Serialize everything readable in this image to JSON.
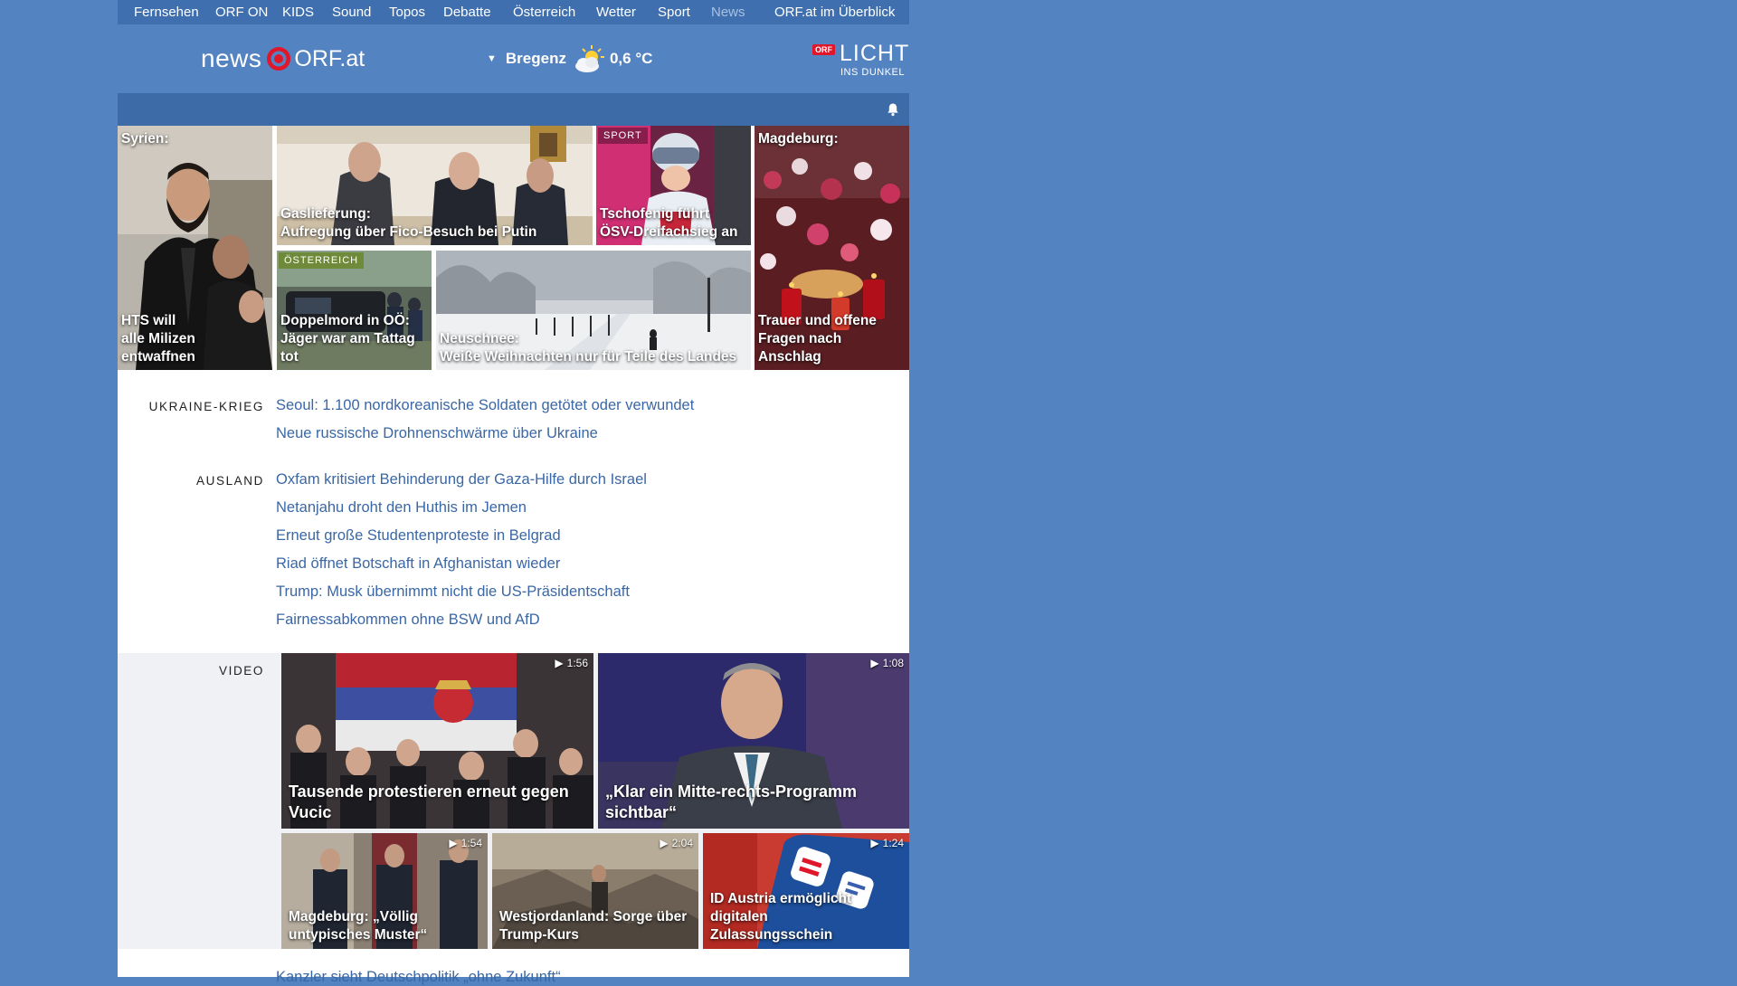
{
  "nav": {
    "items": [
      "Fernsehen",
      "ORF ON",
      "KIDS",
      "Sound",
      "Topos",
      "Debatte",
      "Österreich",
      "Wetter",
      "Sport",
      "News"
    ],
    "overview": "ORF.at im Überblick"
  },
  "header": {
    "logo_news": "news",
    "logo_orf": "ORF.at",
    "weather_city": "Bregenz",
    "weather_temp": "0,6 °C",
    "weather_icon": "partly-cloudy-icon",
    "licht_badge": "ORF",
    "licht_title": "LICHT",
    "licht_sub": "INS DUNKEL"
  },
  "tiles": [
    {
      "top": "Syrien:",
      "caption": "HTS will\nalle Milizen entwaffnen"
    },
    {
      "caption": "Gaslieferung:\nAufregung über Fico-Besuch bei Putin"
    },
    {
      "tag": "SPORT",
      "caption": "Tschofenig führt\nÖSV-Dreifachsieg an"
    },
    {
      "top": "Magdeburg:",
      "caption": "Trauer und offene\nFragen nach Anschlag"
    },
    {
      "tag": "ÖSTERREICH",
      "caption": "Doppelmord in OÖ:\nJäger war am Tattag tot"
    },
    {
      "caption": "Neuschnee:\nWeiße Weihnachten nur für Teile des Landes"
    }
  ],
  "sections": [
    {
      "label": "UKRAINE-KRIEG",
      "headlines": [
        "Seoul: 1.100 nordkoreanische Soldaten getötet oder verwundet",
        "Neue russische Drohnenschwärme über Ukraine"
      ]
    },
    {
      "label": "AUSLAND",
      "headlines": [
        "Oxfam kritisiert Behinderung der Gaza-Hilfe durch Israel",
        "Netanjahu droht den Huthis im Jemen",
        "Erneut große Studentenproteste in Belgrad",
        "Riad öffnet Botschaft in Afghanistan wieder",
        "Trump: Musk übernimmt nicht die US-Präsidentschaft",
        "Fairnessabkommen ohne BSW und AfD"
      ]
    }
  ],
  "video": {
    "label": "VIDEO",
    "items": [
      {
        "duration": "1:56",
        "caption": "Tausende protestieren erneut gegen Vucic"
      },
      {
        "duration": "1:08",
        "caption": "„Klar ein Mitte-rechts-Programm\nsichtbar“"
      },
      {
        "duration": "1:54",
        "caption": "Magdeburg: „Völlig\nuntypisches Muster“"
      },
      {
        "duration": "2:04",
        "caption": "Westjordanland: Sorge über\nTrump-Kurs"
      },
      {
        "duration": "1:24",
        "caption": "ID Austria ermöglicht digitalen\nZulassungsschein"
      }
    ]
  },
  "partial_headline": "Kanzler sieht Deutschpolitik „ohne Zukunft“",
  "colors": {
    "background": "#5483c2",
    "nav": "#3f6fae",
    "link": "#3a67a5",
    "accent_red": "#e0162b"
  }
}
